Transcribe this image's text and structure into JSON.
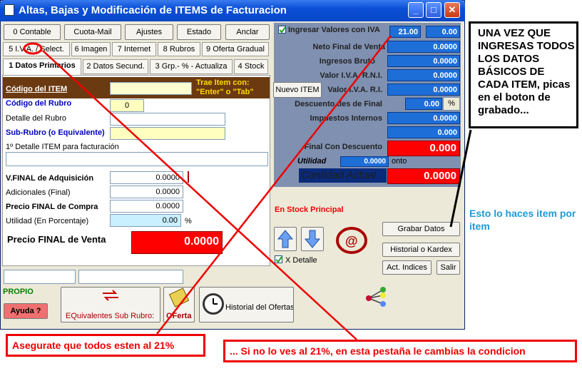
{
  "window": {
    "title": "Altas, Bajas y Modificación de ITEMS de Facturacion",
    "min": "_",
    "max": "□",
    "close": "✕"
  },
  "toolbar": {
    "contable": "0 Contable",
    "cuota_mail": "Cuota-Mail",
    "ajustes": "Ajustes",
    "estado": "Estado",
    "anclar": "Anclar"
  },
  "tabs_row1": [
    "5 I.V.A. / Select.",
    "6 Imagen",
    "7 Internet",
    "8 Rubros",
    "9 Oferta Gradual"
  ],
  "tabs_row2": [
    "1 Datos Primarios",
    "2 Datos Secund.",
    "3 Grp.- % - Actualiza",
    "4 Stock"
  ],
  "form": {
    "codigo_item": "Código del ITEM",
    "trae_item": "Trae Item con:",
    "trae_item_keys": "\"Enter\" o \"Tab\"",
    "codigo_rubro": "Código del Rubro",
    "codigo_rubro_value": "0",
    "detalle_rubro": "Detalle del Rubro",
    "subrubro": "Sub-Rubro (o Equivalente)",
    "detalle_facturacion": "1º Detalle ITEM para facturación",
    "vfinal_adq": "V.FINAL de Adquisición",
    "vfinal_adq_value": "0.0000",
    "adicionales": "Adicionales (Final)",
    "adicionales_value": "0.0000",
    "precio_compra": "Precio FINAL de Compra",
    "precio_compra_value": "0.0000",
    "utilidad": "Utilidad (En Porcentaje)",
    "utilidad_value": "0.00",
    "pct": "%",
    "precio_venta": "Precio FINAL de  Venta",
    "precio_venta_value": "0.0000"
  },
  "right": {
    "ingresar_iva": "Ingresar Valores con IVA",
    "iva_value": "21.00",
    "iva_value2": "0.00",
    "neto_final": "Neto Final de Venta",
    "neto_final_value": "0.0000",
    "ingresos_brutos": "Ingresos Bruto",
    "ingresos_brutos_value": "0.0000",
    "iva_rni": "Valor I.V.A. R.N.I.",
    "iva_rni_value": "0.0000",
    "nuevo_item": "Nuevo ITEM",
    "iva_ri": "Valor I.V.A. R.I.",
    "iva_ri_value": "0.0000",
    "descuento": "Descuento des de Final",
    "descuento_value": "0.00",
    "descuento_pct": "%",
    "impuestos": "Impuestos Internos",
    "impuestos_value": "0.0000",
    "extra_value": "0.000",
    "final_descuento": "Final Con Descuento",
    "final_descuento_value": "0.000",
    "utilidad": "Utilidad",
    "utilidad_value": "0.0000",
    "utilidad_suffix": "onto",
    "cantidad": "Cantidad Actual",
    "cantidad_value": "0.0000",
    "stock_principal": "En Stock Principal",
    "x_detalle": "X Detalle",
    "grabar": "Grabar Datos",
    "historial_kardex": "Historial o Kardex",
    "act_indices": "Act. Indices",
    "salir": "Salir"
  },
  "bottom": {
    "propio": "PROPIO",
    "ayuda": "Ayuda ?",
    "equivalentes": "EQuivalentes Sub Rubro:",
    "oferta": "OFerta",
    "historial_ofertas": "Historial del Ofertas"
  },
  "annotations": {
    "note": "UNA VEZ QUE INGRESAS TODOS LOS DATOS BÁSICOS DE CADA ITEM, picas en el boton de grabado...",
    "item_por_item": "Esto lo haces item por item",
    "asegurate": "Asegurate que todos esten al 21%",
    "si_no": "... Si no lo ves al 21%, en esta pestaña le cambias la condicion"
  },
  "colors": {
    "accent_red": "#ff0000",
    "value_blue": "#1e6ed8",
    "title_blue": "#0a4fd6",
    "brown": "#6b3a10",
    "cyan_note": "#1e9ad6"
  }
}
